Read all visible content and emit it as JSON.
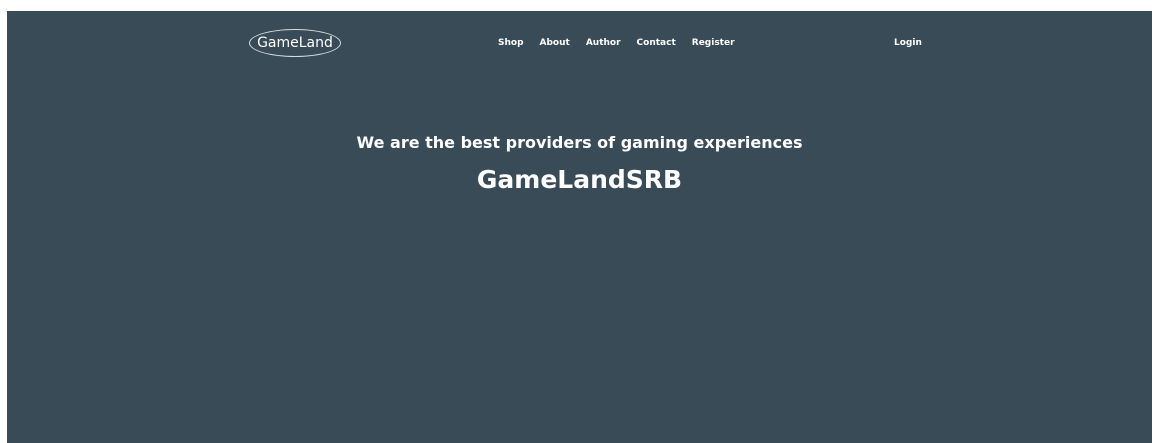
{
  "header": {
    "logo_text": "GameLand",
    "nav": [
      {
        "label": "Shop"
      },
      {
        "label": "About"
      },
      {
        "label": "Author"
      },
      {
        "label": "Contact"
      },
      {
        "label": "Register"
      }
    ],
    "login_label": "Login"
  },
  "hero": {
    "tagline": "We are the best providers of gaming experiences",
    "brand": "GameLandSRB"
  },
  "colors": {
    "background": "#394b57",
    "text": "#ffffff"
  }
}
